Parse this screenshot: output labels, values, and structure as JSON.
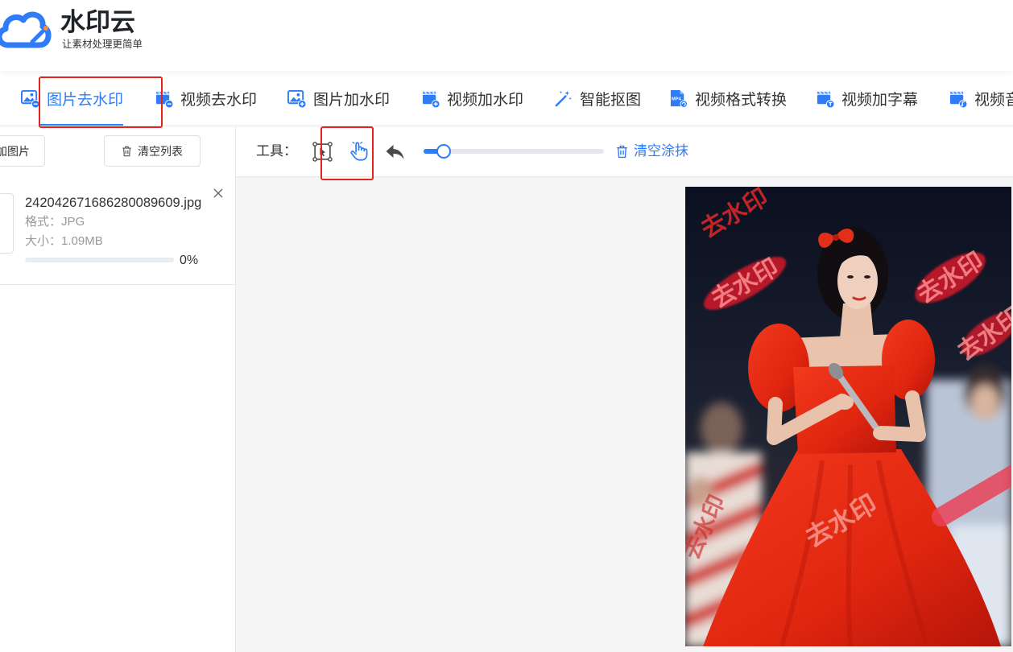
{
  "theme": {
    "accent": "#2f7cf6",
    "text": "#333333",
    "muted": "#999999",
    "annotation": "#e3241c"
  },
  "app": {
    "name": "水印云",
    "slogan": "让素材处理更简单",
    "logo_icon": "cloud-pen-icon"
  },
  "nav": {
    "tabs": [
      {
        "label": "图片去水印",
        "icon": "image-remove-icon",
        "active": true
      },
      {
        "label": "视频去水印",
        "icon": "video-remove-icon"
      },
      {
        "label": "图片加水印",
        "icon": "image-add-icon"
      },
      {
        "label": "视频加水印",
        "icon": "video-add-icon"
      },
      {
        "label": "智能抠图",
        "icon": "magic-wand-icon"
      },
      {
        "label": "视频格式转换",
        "icon": "mp4-file-icon",
        "icon_label": "MP4"
      },
      {
        "label": "视频加字幕",
        "icon": "video-subtitle-icon"
      },
      {
        "label": "视频音",
        "icon": "video-audio-icon"
      }
    ]
  },
  "sidebar": {
    "add_button_label": "加图片",
    "clear_button_label": "清空列表",
    "files": [
      {
        "name": "242042671686280089609.jpg",
        "format": "格式：JPG",
        "size": "大小：1.09MB",
        "progress": 0,
        "progress_text": "0%"
      }
    ]
  },
  "toolbar": {
    "tools_label": "工具：",
    "tools": [
      "select-area-icon",
      "hand-brush-icon",
      "undo-icon"
    ],
    "active_tool": "hand-brush-icon",
    "brush_size": 0.11,
    "clear_paint_label": "清空涂抹"
  },
  "canvas": {
    "watermark_text": "去水印"
  }
}
